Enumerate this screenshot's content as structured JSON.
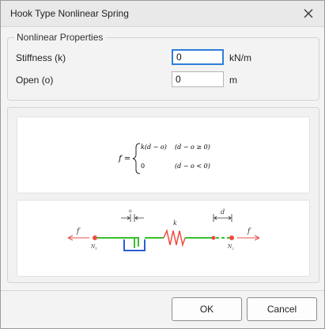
{
  "window": {
    "title": "Hook Type Nonlinear Spring",
    "close_icon": "close-icon"
  },
  "properties": {
    "legend": "Nonlinear Properties",
    "stiffness": {
      "label": "Stiffness (k)",
      "value": "0",
      "unit": "kN/m"
    },
    "open": {
      "label": "Open (o)",
      "value": "0",
      "unit": "m"
    }
  },
  "formula": {
    "lhs": "f =",
    "case1_expr": "k(d − o)",
    "case1_cond": "(d − o ≥ 0)",
    "case2_expr": "0",
    "case2_cond": "(d − o < 0)"
  },
  "diagram": {
    "force_left": "f",
    "force_right": "f",
    "gap_label": "o",
    "spring_label": "k",
    "disp_label": "d",
    "node1_label": "N",
    "node1_sub": "1",
    "node2_label": "N",
    "node2_sub": "2",
    "colors": {
      "element": "#3bbf2d",
      "hook": "#2b5fd6",
      "spring": "#ee4b3f",
      "force": "#e8504a",
      "node": "#ee4b3f"
    }
  },
  "buttons": {
    "ok": "OK",
    "cancel": "Cancel"
  }
}
